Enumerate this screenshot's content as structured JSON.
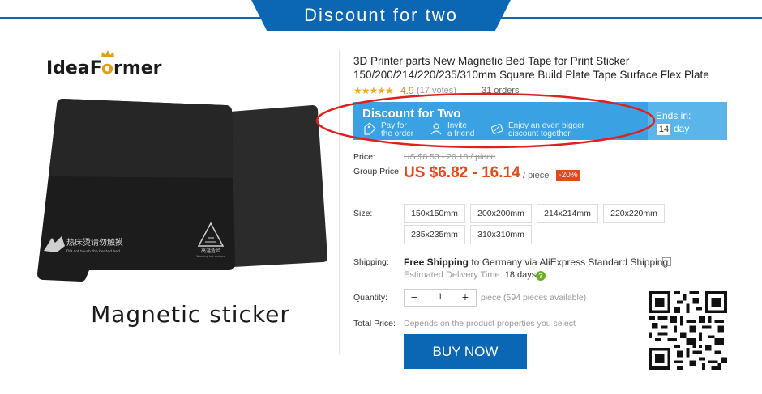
{
  "banner": {
    "title": "Discount for two"
  },
  "brand": {
    "logo_text_1": "Idea",
    "logo_text_2": "F",
    "logo_text_3": "o",
    "logo_text_4": "rmer"
  },
  "product_image": {
    "label_cn": "热床烫请勿触摸",
    "label_en": "DO not touch the heated bed",
    "warning_cn": "高温危险",
    "warning_en": "Warning hot surface"
  },
  "caption": "Magnetic sticker",
  "product": {
    "title": "3D Printer parts New Magnetic Bed Tape for Print Sticker 150/200/214/220/235/310mm Square Build Plate Tape Surface Flex Plate",
    "stars": "★★★★★",
    "rating": "4.9",
    "votes": "(17 votes)",
    "orders": "31 orders"
  },
  "discount": {
    "title": "Discount for Two",
    "features": [
      {
        "icon": "tag-icon",
        "line1": "Pay for",
        "line2": "the order"
      },
      {
        "icon": "friend-icon",
        "line1": "Invite",
        "line2": "a friend"
      },
      {
        "icon": "discount-icon",
        "line1": "Enjoy an even bigger",
        "line2": "discount together"
      }
    ],
    "ends_label": "Ends in:",
    "ends_days": "14",
    "ends_unit": "day",
    "accent": "#3aa1e3"
  },
  "pricing": {
    "price_label": "Price:",
    "price_old": "US $8.53 - 20.18 / piece",
    "group_label": "Group Price:",
    "group_price": "US $6.82 - 16.14",
    "per_piece": "/ piece",
    "discount_badge": "-20%",
    "price_color": "#e4491b"
  },
  "size": {
    "label": "Size:",
    "options": [
      "150x150mm",
      "200x200mm",
      "214x214mm",
      "220x220mm",
      "235x235mm",
      "310x310mm"
    ]
  },
  "shipping": {
    "label": "Shipping:",
    "free_text": "Free Shipping",
    "rest_text": " to Germany via AliExpress Standard Shipping",
    "delivery_label": "Estimated Delivery Time: ",
    "delivery_days": "18 days"
  },
  "quantity": {
    "label": "Quantity:",
    "minus": "−",
    "value": "1",
    "plus": "+",
    "available": "piece (594 pieces available)"
  },
  "total": {
    "label": "Total Price:",
    "value": "Depends on the product properties you select"
  },
  "buy_button": "BUY NOW",
  "colors": {
    "brand_blue": "#0b66b4"
  }
}
